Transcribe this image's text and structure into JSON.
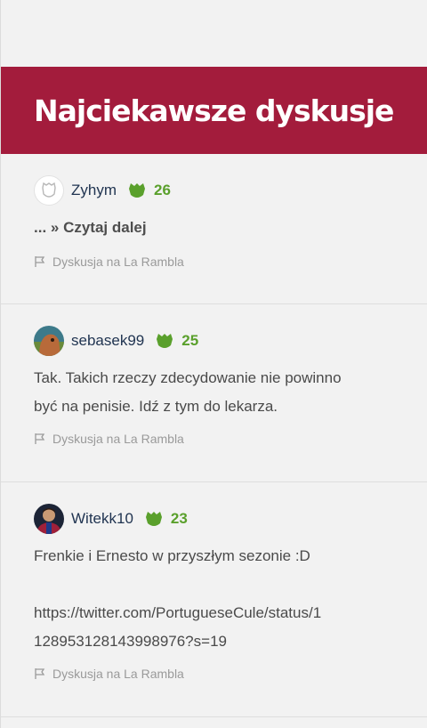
{
  "section": {
    "title": "Najciekawsze dyskusje"
  },
  "colors": {
    "header_bg": "#a31c3c",
    "score_green": "#5aa02c",
    "author_navy": "#1f3350"
  },
  "discussions": [
    {
      "author": "Zyhym",
      "avatar": "default-avatar-icon",
      "score": "26",
      "text_lines": [
        "... » Czytaj dalej"
      ],
      "meta": "Dyskusja na La Rambla"
    },
    {
      "author": "sebasek99",
      "avatar": "user-avatar-photo",
      "score": "25",
      "text_lines": [
        "Tak. Takich rzeczy zdecydowanie nie powinno",
        "być na penisie. Idź z tym do lekarza."
      ],
      "meta": "Dyskusja na La Rambla"
    },
    {
      "author": "Witekk10",
      "avatar": "user-avatar-photo",
      "score": "23",
      "text_lines": [
        "Frenkie i Ernesto w przyszłym sezonie :D",
        "https://twitter.com/PortugueseCule/status/1",
        "128953128143998976?s=19"
      ],
      "meta": "Dyskusja na La Rambla"
    }
  ]
}
